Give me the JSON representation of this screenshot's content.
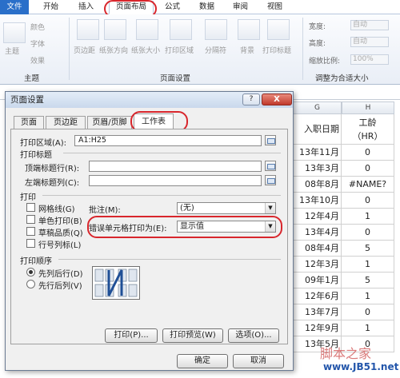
{
  "ribbon_tabs": [
    "文件",
    "开始",
    "插入",
    "页面布局",
    "公式",
    "数据",
    "审阅",
    "视图"
  ],
  "ribbon": {
    "theme_group": {
      "label": "主题",
      "items": [
        "主题",
        "颜色",
        "字体",
        "效果"
      ]
    },
    "page_setup_group": {
      "label": "页面设置",
      "items": [
        "页边距",
        "纸张方向",
        "纸张大小",
        "打印区域",
        "分隔符",
        "背景",
        "打印标题"
      ]
    },
    "scale_group": {
      "label": "调整为合适大小",
      "width_label": "宽度:",
      "width_value": "自动",
      "height_label": "高度:",
      "height_value": "自动",
      "scale_label": "缩放比例:",
      "scale_value": "100%"
    }
  },
  "sheet": {
    "col_g": "G",
    "col_h": "H",
    "header_g": "入职日期",
    "header_h_line1": "工龄",
    "header_h_line2": "（HR）",
    "rows": [
      {
        "g": "13年11月",
        "h": "0"
      },
      {
        "g": "13年3月",
        "h": "0"
      },
      {
        "g": "08年8月",
        "h": "#NAME?"
      },
      {
        "g": "13年10月",
        "h": "0"
      },
      {
        "g": "12年4月",
        "h": "1"
      },
      {
        "g": "13年4月",
        "h": "0"
      },
      {
        "g": "08年4月",
        "h": "5"
      },
      {
        "g": "12年3月",
        "h": "1"
      },
      {
        "g": "09年1月",
        "h": "5"
      },
      {
        "g": "12年6月",
        "h": "1"
      },
      {
        "g": "13年7月",
        "h": "0"
      },
      {
        "g": "12年9月",
        "h": "1"
      },
      {
        "g": "13年5月",
        "h": "0"
      }
    ]
  },
  "watermark": {
    "line1": "脚本之家",
    "line2": "www.JB51.net"
  },
  "dialog": {
    "title": "页面设置",
    "help_button": "?",
    "close_button": "X",
    "tabs": [
      "页面",
      "页边距",
      "页眉/页脚",
      "工作表"
    ],
    "print_area_label": "打印区域(A):",
    "print_area_value": "A1:H25",
    "print_titles_header": "打印标题",
    "top_rows_label": "顶端标题行(R):",
    "top_rows_value": "",
    "left_cols_label": "左端标题列(C):",
    "left_cols_value": "",
    "print_header": "打印",
    "checkboxes": [
      "网格线(G)",
      "单色打印(B)",
      "草稿品质(Q)",
      "行号列标(L)"
    ],
    "comments_label": "批注(M):",
    "comments_value": "(无)",
    "errors_label": "错误单元格打印为(E):",
    "errors_value": "显示值",
    "order_header": "打印顺序",
    "order_options": [
      "先列后行(D)",
      "先行后列(V)"
    ],
    "buttons": {
      "print": "打印(P)...",
      "preview": "打印预览(W)",
      "options": "选项(O)...",
      "ok": "确定",
      "cancel": "取消"
    }
  }
}
